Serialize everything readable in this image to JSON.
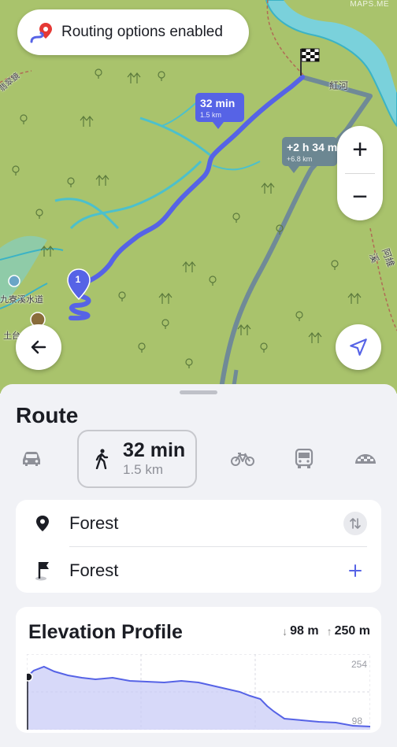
{
  "map": {
    "credit": "MAPS.ME",
    "labels": {
      "river_cjk": "紅河",
      "road_left_cjk": "翡翠鏡",
      "road_right_cjk": "阿維溪",
      "place_left": "九寮溪水道",
      "place_bottom": "土台"
    },
    "routing_banner": "Routing options enabled",
    "primary_route": {
      "time": "32 min",
      "distance": "1.5 km"
    },
    "alt_route": {
      "time": "+2 h 34 m",
      "distance": "+6.8 km"
    },
    "start_marker": "1",
    "zoom_in": "+",
    "zoom_out": "−"
  },
  "sheet": {
    "title": "Route",
    "modes": [
      {
        "id": "car",
        "icon": "car-icon"
      },
      {
        "id": "walk",
        "icon": "walk-icon",
        "time": "32 min",
        "distance": "1.5 km",
        "active": true
      },
      {
        "id": "bike",
        "icon": "bike-icon"
      },
      {
        "id": "transit",
        "icon": "bus-icon"
      },
      {
        "id": "taxi",
        "icon": "taxi-icon"
      }
    ],
    "start": {
      "name": "Forest"
    },
    "finish": {
      "name": "Forest"
    },
    "elevation": {
      "title": "Elevation Profile",
      "descent": "98 m",
      "ascent": "250 m",
      "max_label": "254",
      "min_label": "98"
    }
  },
  "chart_data": {
    "type": "area",
    "title": "Elevation Profile",
    "xlabel": "",
    "ylabel": "",
    "ylim": [
      98,
      254
    ],
    "x": [
      0,
      0.02,
      0.05,
      0.08,
      0.12,
      0.16,
      0.2,
      0.25,
      0.3,
      0.35,
      0.4,
      0.45,
      0.5,
      0.55,
      0.6,
      0.62,
      0.65,
      0.68,
      0.7,
      0.72,
      0.75,
      0.8,
      0.85,
      0.9,
      0.95,
      1.0
    ],
    "values": [
      224,
      240,
      250,
      238,
      228,
      222,
      218,
      222,
      214,
      212,
      210,
      214,
      210,
      200,
      190,
      186,
      176,
      168,
      150,
      136,
      118,
      114,
      110,
      108,
      100,
      98
    ],
    "colors": {
      "line": "#5663e6",
      "fill": "#c9ccf7"
    }
  }
}
